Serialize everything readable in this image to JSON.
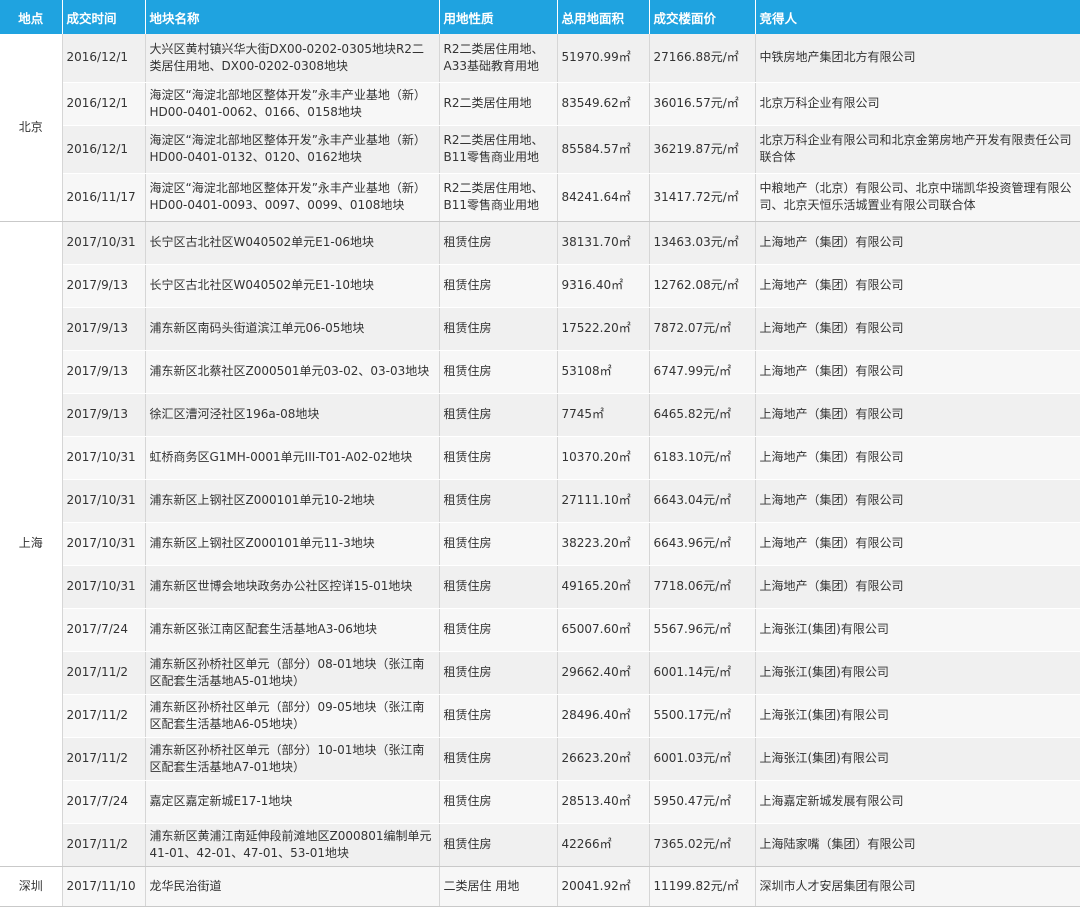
{
  "headers": [
    "地点",
    "成交时间",
    "地块名称",
    "用地性质",
    "总用地面积",
    "成交楼面价",
    "竞得人"
  ],
  "groups": [
    {
      "city": "北京",
      "rows": [
        {
          "date": "2016/12/1",
          "name": "大兴区黄村镇兴华大街DX00-0202-0305地块R2二类居住用地、DX00-0202-0308地块",
          "use": "R2二类居住用地、A33基础教育用地",
          "area": "51970.99㎡",
          "price": "27166.88元/㎡",
          "winner": "中铁房地产集团北方有限公司"
        },
        {
          "date": "2016/12/1",
          "name": "海淀区“海淀北部地区整体开发”永丰产业基地（新）HD00-0401-0062、0166、0158地块",
          "use": "R2二类居住用地",
          "area": "83549.62㎡",
          "price": "36016.57元/㎡",
          "winner": "北京万科企业有限公司"
        },
        {
          "date": "2016/12/1",
          "name": "海淀区“海淀北部地区整体开发”永丰产业基地（新）HD00-0401-0132、0120、0162地块",
          "use": "R2二类居住用地、B11零售商业用地",
          "area": "85584.57㎡",
          "price": "36219.87元/㎡",
          "winner": "北京万科企业有限公司和北京金第房地产开发有限责任公司联合体"
        },
        {
          "date": "2016/11/17",
          "name": "海淀区“海淀北部地区整体开发”永丰产业基地（新）HD00-0401-0093、0097、0099、0108地块",
          "use": "R2二类居住用地、B11零售商业用地",
          "area": "84241.64㎡",
          "price": "31417.72元/㎡",
          "winner": "中粮地产（北京）有限公司、北京中瑞凯华投资管理有限公司、北京天恒乐活城置业有限公司联合体"
        }
      ]
    },
    {
      "city": "上海",
      "rows": [
        {
          "date": "2017/10/31",
          "name": "长宁区古北社区W040502单元E1-06地块",
          "use": "租赁住房",
          "area": "38131.70㎡",
          "price": "13463.03元/㎡",
          "winner": "上海地产（集团）有限公司"
        },
        {
          "date": "2017/9/13",
          "name": "长宁区古北社区W040502单元E1-10地块",
          "use": "租赁住房",
          "area": "9316.40㎡",
          "price": "12762.08元/㎡",
          "winner": "上海地产（集团）有限公司"
        },
        {
          "date": "2017/9/13",
          "name": "浦东新区南码头街道滨江单元06-05地块",
          "use": "租赁住房",
          "area": "17522.20㎡",
          "price": "7872.07元/㎡",
          "winner": "上海地产（集团）有限公司"
        },
        {
          "date": "2017/9/13",
          "name": "浦东新区北蔡社区Z000501单元03-02、03-03地块",
          "use": "租赁住房",
          "area": "53108㎡",
          "price": "6747.99元/㎡",
          "winner": "上海地产（集团）有限公司"
        },
        {
          "date": "2017/9/13",
          "name": "徐汇区漕河泾社区196a-08地块",
          "use": "租赁住房",
          "area": "7745㎡",
          "price": "6465.82元/㎡",
          "winner": "上海地产（集团）有限公司"
        },
        {
          "date": "2017/10/31",
          "name": "虹桥商务区G1MH-0001单元III-T01-A02-02地块",
          "use": "租赁住房",
          "area": "10370.20㎡",
          "price": "6183.10元/㎡",
          "winner": "上海地产（集团）有限公司"
        },
        {
          "date": "2017/10/31",
          "name": "浦东新区上钢社区Z000101单元10-2地块",
          "use": "租赁住房",
          "area": "27111.10㎡",
          "price": "6643.04元/㎡",
          "winner": "上海地产（集团）有限公司"
        },
        {
          "date": "2017/10/31",
          "name": "浦东新区上钢社区Z000101单元11-3地块",
          "use": "租赁住房",
          "area": "38223.20㎡",
          "price": "6643.96元/㎡",
          "winner": "上海地产（集团）有限公司"
        },
        {
          "date": "2017/10/31",
          "name": "浦东新区世博会地块政务办公社区控详15-01地块",
          "use": "租赁住房",
          "area": "49165.20㎡",
          "price": "7718.06元/㎡",
          "winner": "上海地产（集团）有限公司"
        },
        {
          "date": "2017/7/24",
          "name": "浦东新区张江南区配套生活基地A3-06地块",
          "use": "租赁住房",
          "area": "65007.60㎡",
          "price": "5567.96元/㎡",
          "winner": "上海张江(集团)有限公司"
        },
        {
          "date": "2017/11/2",
          "name": "浦东新区孙桥社区单元（部分）08-01地块（张江南区配套生活基地A5-01地块）",
          "use": "租赁住房",
          "area": "29662.40㎡",
          "price": "6001.14元/㎡",
          "winner": "上海张江(集团)有限公司"
        },
        {
          "date": "2017/11/2",
          "name": "浦东新区孙桥社区单元（部分）09-05地块（张江南区配套生活基地A6-05地块）",
          "use": "租赁住房",
          "area": "28496.40㎡",
          "price": "5500.17元/㎡",
          "winner": "上海张江(集团)有限公司"
        },
        {
          "date": "2017/11/2",
          "name": "浦东新区孙桥社区单元（部分）10-01地块（张江南区配套生活基地A7-01地块）",
          "use": "租赁住房",
          "area": "26623.20㎡",
          "price": "6001.03元/㎡",
          "winner": "上海张江(集团)有限公司"
        },
        {
          "date": "2017/7/24",
          "name": "嘉定区嘉定新城E17-1地块",
          "use": "租赁住房",
          "area": "28513.40㎡",
          "price": "5950.47元/㎡",
          "winner": "上海嘉定新城发展有限公司"
        },
        {
          "date": "2017/11/2",
          "name": "浦东新区黄浦江南延伸段前滩地区Z000801编制单元41-01、42-01、47-01、53-01地块",
          "use": "租赁住房",
          "area": "42266㎡",
          "price": "7365.02元/㎡",
          "winner": "上海陆家嘴（集团）有限公司"
        }
      ]
    },
    {
      "city": "深圳",
      "rows": [
        {
          "date": "2017/11/10",
          "name": "龙华民治街道",
          "use": "二类居住 用地",
          "area": "20041.92㎡",
          "price": "11199.82元/㎡",
          "winner": "深圳市人才安居集团有限公司"
        }
      ]
    }
  ]
}
